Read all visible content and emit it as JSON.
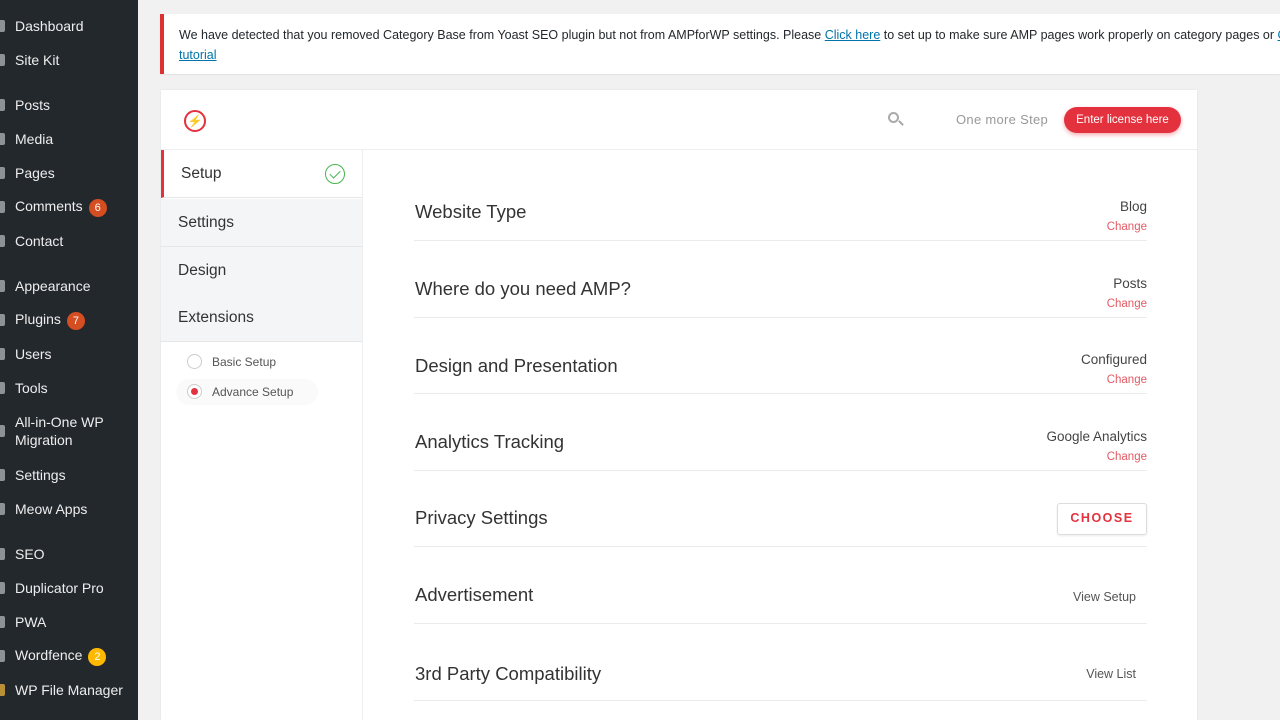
{
  "sidebar": {
    "items": [
      {
        "label": "Dashboard"
      },
      {
        "label": "Site Kit"
      },
      {
        "label": "Posts"
      },
      {
        "label": "Media"
      },
      {
        "label": "Pages"
      },
      {
        "label": "Comments",
        "badge": "6"
      },
      {
        "label": "Contact"
      },
      {
        "label": "Appearance"
      },
      {
        "label": "Plugins",
        "badge": "7"
      },
      {
        "label": "Users"
      },
      {
        "label": "Tools"
      },
      {
        "label": "All-in-One WP Migration"
      },
      {
        "label": "Settings"
      },
      {
        "label": "Meow Apps"
      },
      {
        "label": "SEO"
      },
      {
        "label": "Duplicator Pro"
      },
      {
        "label": "PWA"
      },
      {
        "label": "Wordfence",
        "badge": "2"
      },
      {
        "label": "WP File Manager"
      }
    ]
  },
  "notice": {
    "text_before": "We have detected that you removed Category Base from Yoast SEO plugin but not from AMPforWP settings. Please ",
    "link1": "Click here",
    "text_after": " to set up to make sure AMP pages work properly on category pages or ",
    "link2_partial": "Cl",
    "link2_line2": "tutorial"
  },
  "header": {
    "step_text": "One more Step",
    "license_button": "Enter license here"
  },
  "nav": {
    "items": [
      "Setup",
      "Settings",
      "Design",
      "Extensions"
    ],
    "sub_options": [
      "Basic Setup",
      "Advance Setup"
    ]
  },
  "rows": [
    {
      "title": "Website Type",
      "value": "Blog",
      "change": "Change"
    },
    {
      "title": "Where do you need AMP?",
      "value": "Posts",
      "change": "Change"
    },
    {
      "title": "Design and Presentation",
      "value": "Configured",
      "change": "Change"
    },
    {
      "title": "Analytics Tracking",
      "value": "Google Analytics",
      "change": "Change"
    },
    {
      "title": "Privacy Settings",
      "button": "CHOOSE"
    },
    {
      "title": "Advertisement",
      "link": "View Setup"
    },
    {
      "title": "3rd Party Compatibility",
      "link": "View List"
    }
  ],
  "colors": {
    "accent": "#e3323e",
    "sidebar_bg": "#23282d",
    "success": "#46b450"
  }
}
